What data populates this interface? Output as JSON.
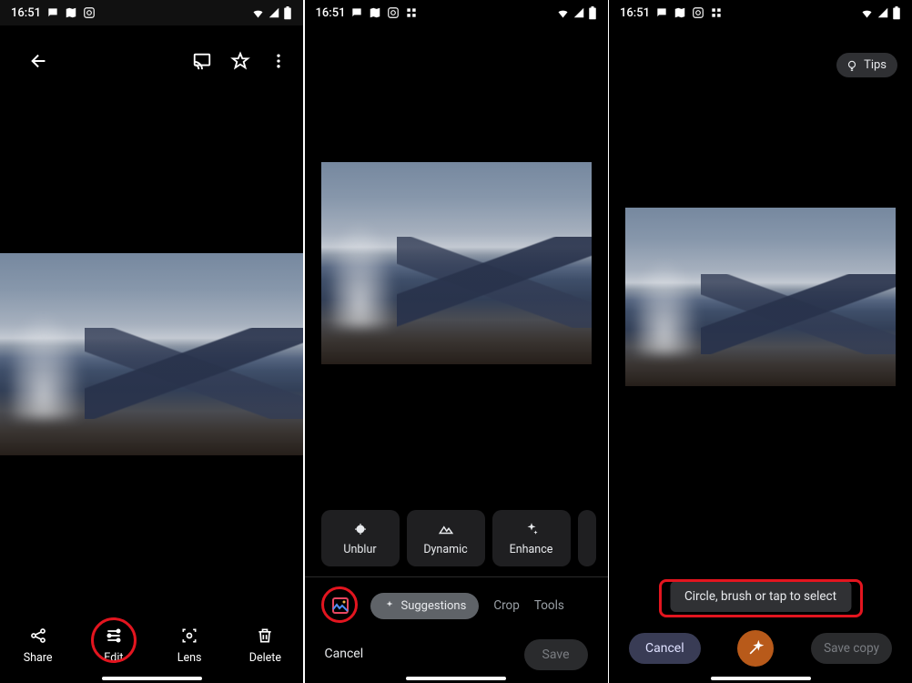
{
  "status": {
    "time": "16:51",
    "icons_left": [
      "chat-icon",
      "map-icon",
      "camera-icon",
      "apps-icon"
    ],
    "icons_right": [
      "wifi-icon",
      "signal-icon",
      "battery-icon"
    ]
  },
  "screen1": {
    "actions": {
      "share": "Share",
      "edit": "Edit",
      "lens": "Lens",
      "delete": "Delete"
    }
  },
  "screen2": {
    "chips": {
      "unblur": "Unblur",
      "dynamic": "Dynamic",
      "enhance": "Enhance"
    },
    "toolbar": {
      "suggestions": "Suggestions",
      "crop": "Crop",
      "tools": "Tools",
      "cancel": "Cancel",
      "save": "Save"
    }
  },
  "screen3": {
    "tips": "Tips",
    "instruction": "Circle, brush or tap to select",
    "cancel": "Cancel",
    "save_copy": "Save copy"
  }
}
